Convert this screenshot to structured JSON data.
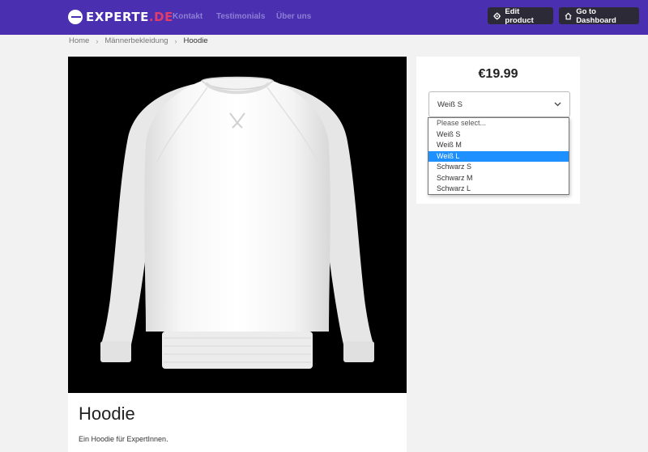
{
  "header": {
    "logo_text": "EXPERTE",
    "logo_tld": ".DE",
    "nav": [
      "Kontakt",
      "Testimonials",
      "Über uns"
    ],
    "edit_button": "Edit product",
    "dashboard_button": "Go to Dashboard",
    "colors": {
      "bar": "#4a2fb0",
      "accent": "#e23c6a",
      "buttons": "#2d2a38"
    }
  },
  "breadcrumb": {
    "items": [
      "Home",
      "Männerbekleidung",
      "Hoodie"
    ]
  },
  "product": {
    "title": "Hoodie",
    "description": "Ein Hoodie für ExpertInnen.",
    "price": "€19.99",
    "image": "white-sweatshirt-on-black"
  },
  "variant_select": {
    "value": "Weiß S",
    "options": [
      "Please select...",
      "Weiß S",
      "Weiß M",
      "Weiß L",
      "Schwarz S",
      "Schwarz M",
      "Schwarz L"
    ],
    "highlighted": "Weiß L",
    "highlight_color": "#1e90ff"
  }
}
